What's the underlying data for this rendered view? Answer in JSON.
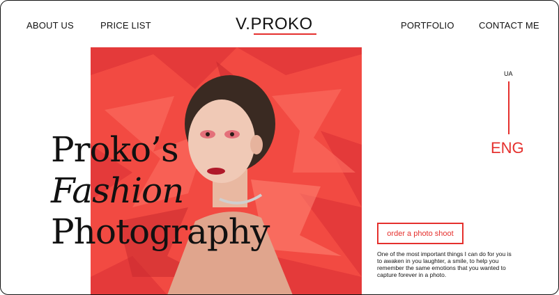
{
  "nav": {
    "about": "ABOUT US",
    "price": "PRICE LIST",
    "portfolio": "PORTFOLIO",
    "contact": "CONTACT ME"
  },
  "logo": "V.PROKO",
  "hero": {
    "line1": "Proko’s",
    "line2": "Fashion",
    "line3": "Photography"
  },
  "lang": {
    "ua": "UA",
    "eng": "ENG"
  },
  "cta": "order a photo shoot",
  "description": "One of the most important things I can do for you is to awaken in you laughter, a smile, to help you remember the same emotions that you wanted to capture forever in a photo.",
  "colors": {
    "accent": "#e5302d",
    "photo_bg": "#e8463f",
    "text": "#111111"
  }
}
